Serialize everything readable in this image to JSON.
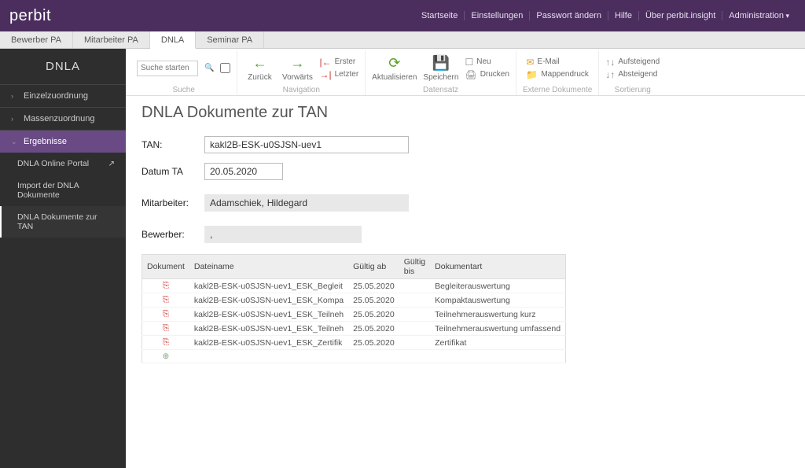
{
  "brand": "perbit",
  "topnav": {
    "startseite": "Startseite",
    "einstellungen": "Einstellungen",
    "pw": "Passwort ändern",
    "hilfe": "Hilfe",
    "ueber": "Über perbit.insight",
    "admin": "Administration"
  },
  "tabs": {
    "bewerber": "Bewerber PA",
    "mitarbeiter": "Mitarbeiter PA",
    "dnla": "DNLA",
    "seminar": "Seminar PA"
  },
  "sidebar": {
    "title": "DNLA",
    "einzel": "Einzelzuordnung",
    "massen": "Massenzuordnung",
    "erg": "Ergebnisse",
    "portal": "DNLA Online Portal",
    "import": "Import der DNLA Dokumente",
    "dok": "DNLA Dokumente zur TAN"
  },
  "ribbon": {
    "search_ph": "Suche starten",
    "g_suche": "Suche",
    "zurueck": "Zurück",
    "vorwaerts": "Vorwärts",
    "erster": "Erster",
    "letzter": "Letzter",
    "g_nav": "Navigation",
    "akt": "Aktualisieren",
    "speich": "Speichern",
    "neu": "Neu",
    "druck": "Drucken",
    "g_dat": "Datensatz",
    "email": "E-Mail",
    "mappen": "Mappendruck",
    "g_ext": "Externe Dokumente",
    "auf": "Aufsteigend",
    "ab": "Absteigend",
    "g_sort": "Sortierung"
  },
  "page": {
    "title": "DNLA Dokumente zur TAN",
    "tan_lbl": "TAN:",
    "tan_val": "kakl2B-ESK-u0SJSN-uev1",
    "datum_lbl": "Datum TA",
    "datum_val": "20.05.2020",
    "mit_lbl": "Mitarbeiter:",
    "mit_last": "Adamschiek,",
    "mit_first": "Hildegard",
    "bew_lbl": "Bewerber:",
    "bew_val": ",",
    "th_dok": "Dokument",
    "th_datei": "Dateiname",
    "th_gab": "Gültig ab",
    "th_gbis": "Gültig bis",
    "th_art": "Dokumentart",
    "rows": [
      {
        "file": "kakl2B-ESK-u0SJSN-uev1_ESK_Begleit",
        "gab": "25.05.2020",
        "art": "Begleiterauswertung"
      },
      {
        "file": "kakl2B-ESK-u0SJSN-uev1_ESK_Kompa",
        "gab": "25.05.2020",
        "art": "Kompaktauswertung"
      },
      {
        "file": "kakl2B-ESK-u0SJSN-uev1_ESK_Teilneh",
        "gab": "25.05.2020",
        "art": "Teilnehmerauswertung kurz"
      },
      {
        "file": "kakl2B-ESK-u0SJSN-uev1_ESK_Teilneh",
        "gab": "25.05.2020",
        "art": "Teilnehmerauswertung umfassend"
      },
      {
        "file": "kakl2B-ESK-u0SJSN-uev1_ESK_Zertifik",
        "gab": "25.05.2020",
        "art": "Zertifikat"
      }
    ]
  }
}
